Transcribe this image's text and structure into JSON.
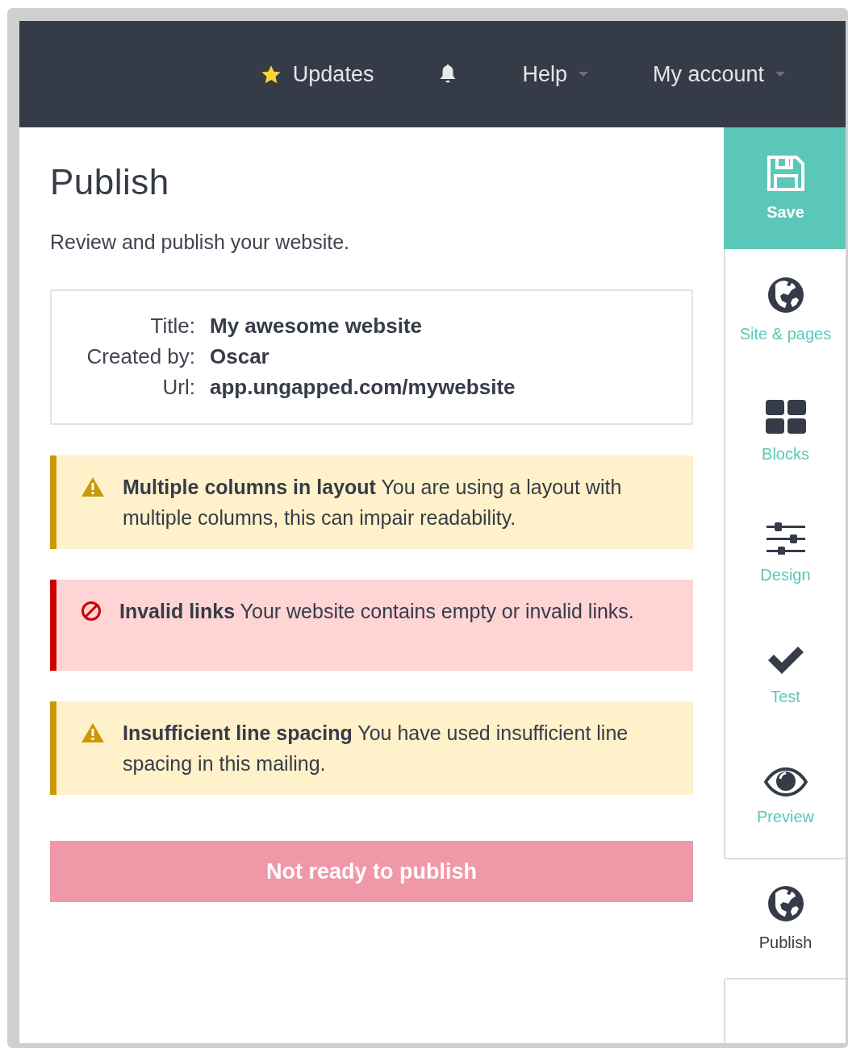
{
  "header": {
    "items": [
      {
        "kind": "starred",
        "label": "Updates"
      },
      {
        "kind": "bell"
      },
      {
        "kind": "dropdown",
        "label": "Help"
      },
      {
        "kind": "dropdown",
        "label": "My account"
      }
    ]
  },
  "page": {
    "title": "Publish",
    "subtitle": "Review and publish your website.",
    "details": [
      {
        "label": "Title:",
        "value": "My awesome website"
      },
      {
        "label": "Created by:",
        "value": "Oscar"
      },
      {
        "label": "Url:",
        "value": "app.ungapped.com/mywebsite"
      }
    ],
    "alerts": [
      {
        "kind": "warning",
        "text": "**Multiple columns in layout** You are using a layout with multiple columns, this can impair readability."
      },
      {
        "kind": "error",
        "text": "**Invalid links** Your website contains empty or invalid links."
      },
      {
        "kind": "warning",
        "text": "**Insufficient line spacing** You have used insufficient line spacing in this mailing."
      }
    ],
    "button": {
      "label": "Not ready to publish",
      "disabled": true
    }
  },
  "sidebar": {
    "items": [
      {
        "kind": "save",
        "label": "Save",
        "selected": false
      },
      {
        "kind": "globe",
        "label": "Site & pages",
        "selected": false
      },
      {
        "kind": "blocks",
        "label": "Blocks",
        "selected": false
      },
      {
        "kind": "design",
        "label": "Design",
        "selected": false
      },
      {
        "kind": "test",
        "label": "Test",
        "selected": false
      },
      {
        "kind": "preview",
        "label": "Preview",
        "selected": false
      },
      {
        "kind": "globe",
        "label": "Publish",
        "selected": true
      }
    ]
  }
}
